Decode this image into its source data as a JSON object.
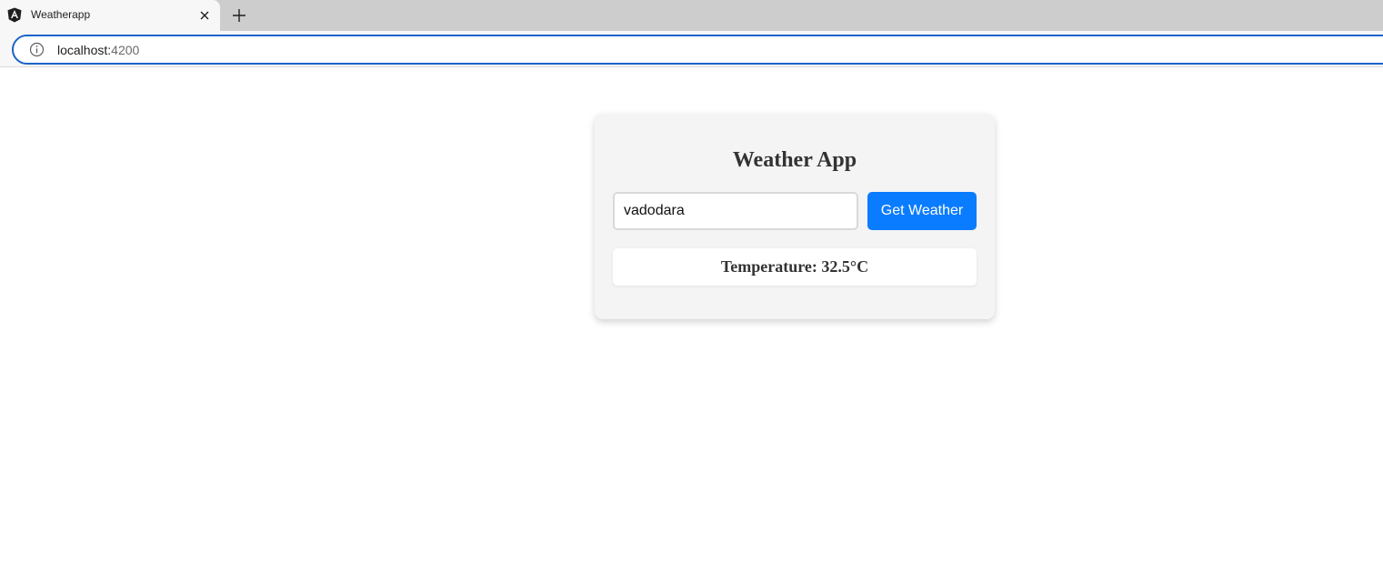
{
  "browser": {
    "tab_title": "Weatherapp",
    "url_host": "localhost:",
    "url_port": "4200",
    "favicon": "angular-logo-icon",
    "accent_color": "#1a63c9"
  },
  "app": {
    "title": "Weather App",
    "city_input_value": "vadodara",
    "get_button_label": "Get Weather",
    "result_text": "Temperature: 32.5°C",
    "button_color": "#0a7cff"
  }
}
